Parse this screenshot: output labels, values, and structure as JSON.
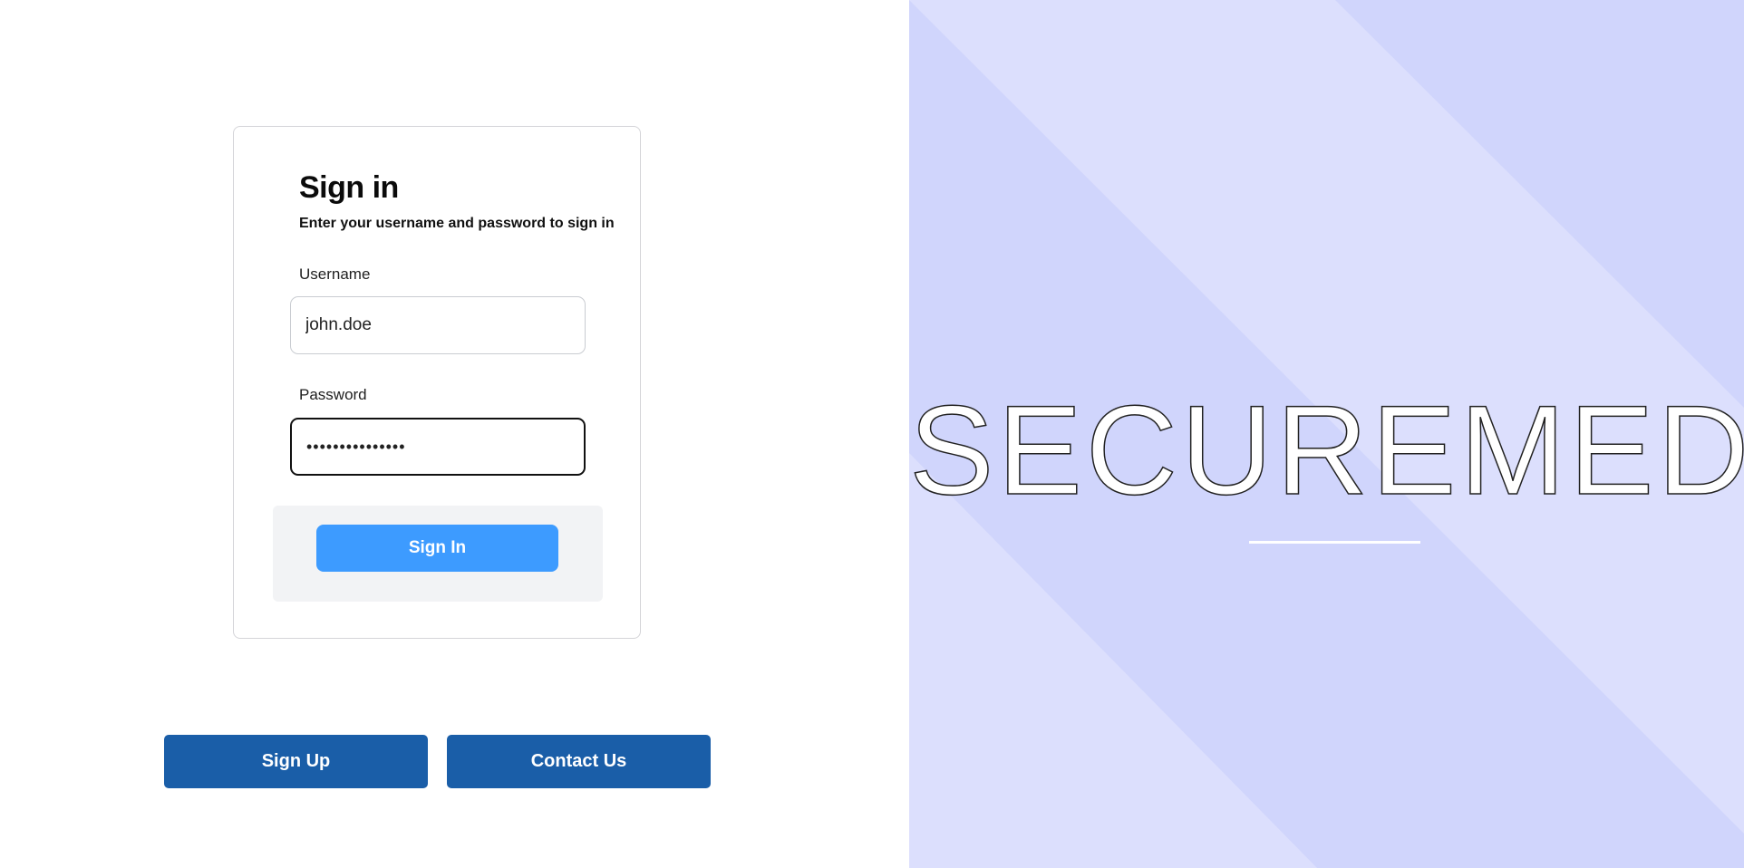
{
  "login": {
    "title": "Sign in",
    "subtitle": "Enter your username and password to sign in",
    "username_label": "Username",
    "username_value": "john.doe",
    "password_label": "Password",
    "password_value": "•••••••••••••••",
    "submit_label": "Sign In"
  },
  "footer_buttons": {
    "signup_label": "Sign Up",
    "contact_label": "Contact Us"
  },
  "brand": {
    "name": "SECUREMED"
  },
  "colors": {
    "primary_button": "#3d9bff",
    "secondary_button": "#1a5ea8",
    "brand_panel_light": "#dcdffd",
    "brand_panel_dark": "#cfd4fc"
  }
}
